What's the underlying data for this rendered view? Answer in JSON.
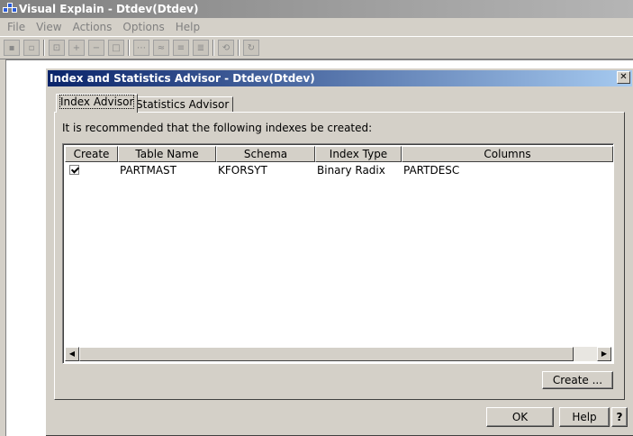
{
  "app": {
    "title": "Visual Explain - Dtdev(Dtdev)",
    "menu": [
      "File",
      "View",
      "Actions",
      "Options",
      "Help"
    ]
  },
  "dialog": {
    "title": "Index and Statistics Advisor - Dtdev(Dtdev)",
    "close_label": "✕",
    "tabs": [
      "Index Advisor",
      "Statistics Advisor"
    ],
    "recommend_text": "It is recommended that the following indexes be created:",
    "columns": [
      "Create",
      "Table Name",
      "Schema",
      "Index Type",
      "Columns"
    ],
    "rows": [
      {
        "create": true,
        "table_name": "PARTMAST",
        "schema": "KFORSYT",
        "index_type": "Binary Radix",
        "columns": "PARTDESC"
      }
    ],
    "create_button": "Create ...",
    "ok_button": "OK",
    "help_button": "Help",
    "question_button": "?"
  }
}
